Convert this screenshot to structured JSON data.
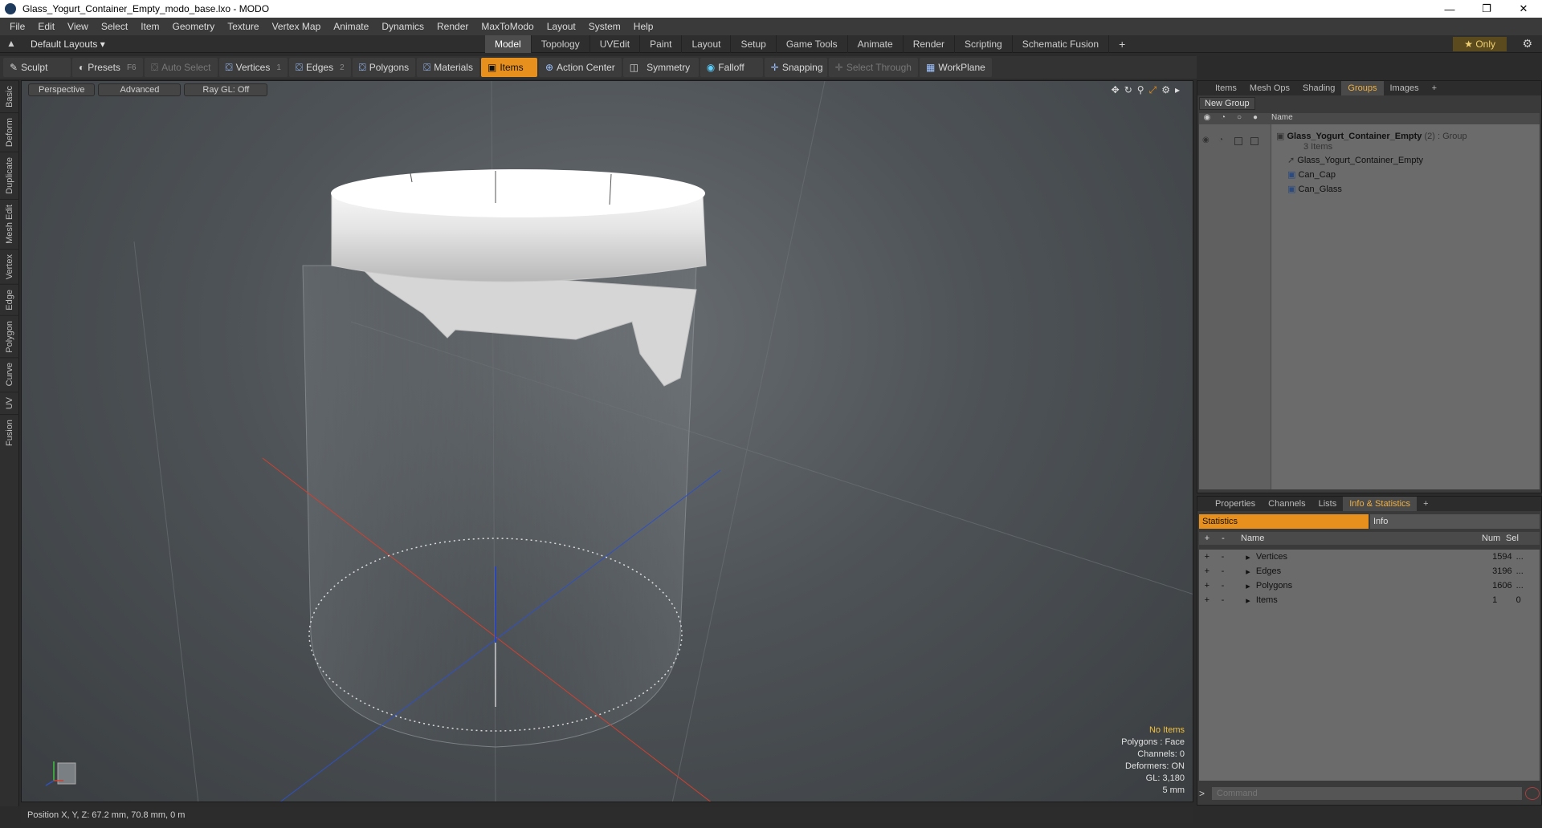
{
  "window": {
    "title": "Glass_Yogurt_Container_Empty_modo_base.lxo - MODO"
  },
  "menu": [
    "File",
    "Edit",
    "View",
    "Select",
    "Item",
    "Geometry",
    "Texture",
    "Vertex Map",
    "Animate",
    "Dynamics",
    "Render",
    "MaxToModo",
    "Layout",
    "System",
    "Help"
  ],
  "layout": {
    "name": "Default Layouts",
    "tabs": [
      "Model",
      "Topology",
      "UVEdit",
      "Paint",
      "Layout",
      "Setup",
      "Game Tools",
      "Animate",
      "Render",
      "Scripting",
      "Schematic Fusion"
    ],
    "active_tab": "Model",
    "only_label": "Only"
  },
  "toolbar": {
    "sculpt": "Sculpt",
    "presets": "Presets",
    "presets_key": "F6",
    "auto_select": "Auto Select",
    "vertices": "Vertices",
    "vertices_key": "1",
    "edges": "Edges",
    "edges_key": "2",
    "polygons": "Polygons",
    "materials": "Materials",
    "items": "Items",
    "action_center": "Action Center",
    "symmetry": "Symmetry",
    "falloff": "Falloff",
    "snapping": "Snapping",
    "select_through": "Select Through",
    "workplane": "WorkPlane"
  },
  "left_tabs": [
    "Basic",
    "Deform",
    "Duplicate",
    "Mesh Edit",
    "Vertex",
    "Edge",
    "Polygon",
    "Curve",
    "UV",
    "Fusion"
  ],
  "viewport": {
    "view": "Perspective",
    "mode": "Advanced",
    "raygl": "Ray GL: Off",
    "info": {
      "no_items": "No Items",
      "polygons": "Polygons : Face",
      "channels": "Channels: 0",
      "deformers": "Deformers: ON",
      "gl": "GL: 3,180",
      "scale": "5 mm"
    }
  },
  "status": {
    "position": "Position X, Y, Z:  67.2 mm, 70.8 mm, 0 m"
  },
  "groups_panel": {
    "tabs": [
      "Items",
      "Mesh Ops",
      "Shading",
      "Groups",
      "Images"
    ],
    "active_tab": "Groups",
    "new_group": "New Group",
    "name_header": "Name",
    "group_name": "Glass_Yogurt_Container_Empty",
    "group_count": "(2)",
    "group_type": ": Group",
    "group_items": "3 Items",
    "children": [
      "Glass_Yogurt_Container_Empty",
      "Can_Cap",
      "Can_Glass"
    ]
  },
  "stats_panel": {
    "tabs": [
      "Properties",
      "Channels",
      "Lists",
      "Info & Statistics"
    ],
    "active_tab": "Info & Statistics",
    "sub_tabs": [
      "Statistics",
      "Info"
    ],
    "headers": {
      "name": "Name",
      "num": "Num",
      "sel": "Sel"
    },
    "rows": [
      {
        "name": "Vertices",
        "num": "1594",
        "sel": "..."
      },
      {
        "name": "Edges",
        "num": "3196",
        "sel": "..."
      },
      {
        "name": "Polygons",
        "num": "1606",
        "sel": "..."
      },
      {
        "name": "Items",
        "num": "1",
        "sel": "0"
      }
    ],
    "command_placeholder": "Command"
  },
  "colors": {
    "accent": "#e8901e",
    "x_axis": "#d04030",
    "z_axis": "#3050c0",
    "y_axis": "#2040d0"
  }
}
